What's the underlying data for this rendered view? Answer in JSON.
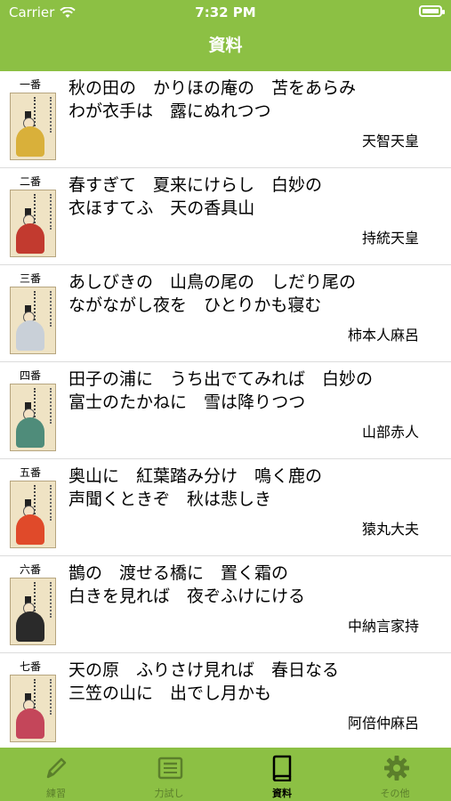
{
  "status": {
    "carrier": "Carrier",
    "time": "7:32 PM"
  },
  "header": {
    "title": "資料"
  },
  "poems": [
    {
      "num": "一番",
      "line1": "秋の田の　かりほの庵の　苫をあらみ",
      "line2": "わが衣手は　露にぬれつつ",
      "author": "天智天皇",
      "robe_color": "#d9b03a"
    },
    {
      "num": "二番",
      "line1": "春すぎて　夏来にけらし　白妙の",
      "line2": "衣ほすてふ　天の香具山",
      "author": "持統天皇",
      "robe_color": "#c23a2f"
    },
    {
      "num": "三番",
      "line1": "あしびきの　山鳥の尾の　しだり尾の",
      "line2": "ながながし夜を　ひとりかも寝む",
      "author": "柿本人麻呂",
      "robe_color": "#c9d0d8"
    },
    {
      "num": "四番",
      "line1": "田子の浦に　うち出でてみれば　白妙の",
      "line2": "富士のたかねに　雪は降りつつ",
      "author": "山部赤人",
      "robe_color": "#4f8c7a"
    },
    {
      "num": "五番",
      "line1": "奥山に　紅葉踏み分け　鳴く鹿の",
      "line2": "声聞くときぞ　秋は悲しき",
      "author": "猿丸大夫",
      "robe_color": "#e04a2a"
    },
    {
      "num": "六番",
      "line1": "鵲の　渡せる橋に　置く霜の",
      "line2": "白きを見れば　夜ぞふけにける",
      "author": "中納言家持",
      "robe_color": "#2a2a2a"
    },
    {
      "num": "七番",
      "line1": "天の原　ふりさけ見れば　春日なる",
      "line2": "三笠の山に　出でし月かも",
      "author": "阿倍仲麻呂",
      "robe_color": "#c4465a"
    }
  ],
  "tabs": [
    {
      "label": "練習",
      "icon": "pencil-icon",
      "active": false
    },
    {
      "label": "力試し",
      "icon": "newspaper-icon",
      "active": false
    },
    {
      "label": "資料",
      "icon": "book-icon",
      "active": true
    },
    {
      "label": "その他",
      "icon": "gear-icon",
      "active": false
    }
  ],
  "colors": {
    "accent": "#8cc044",
    "tab_inactive": "#5b7f2b"
  }
}
